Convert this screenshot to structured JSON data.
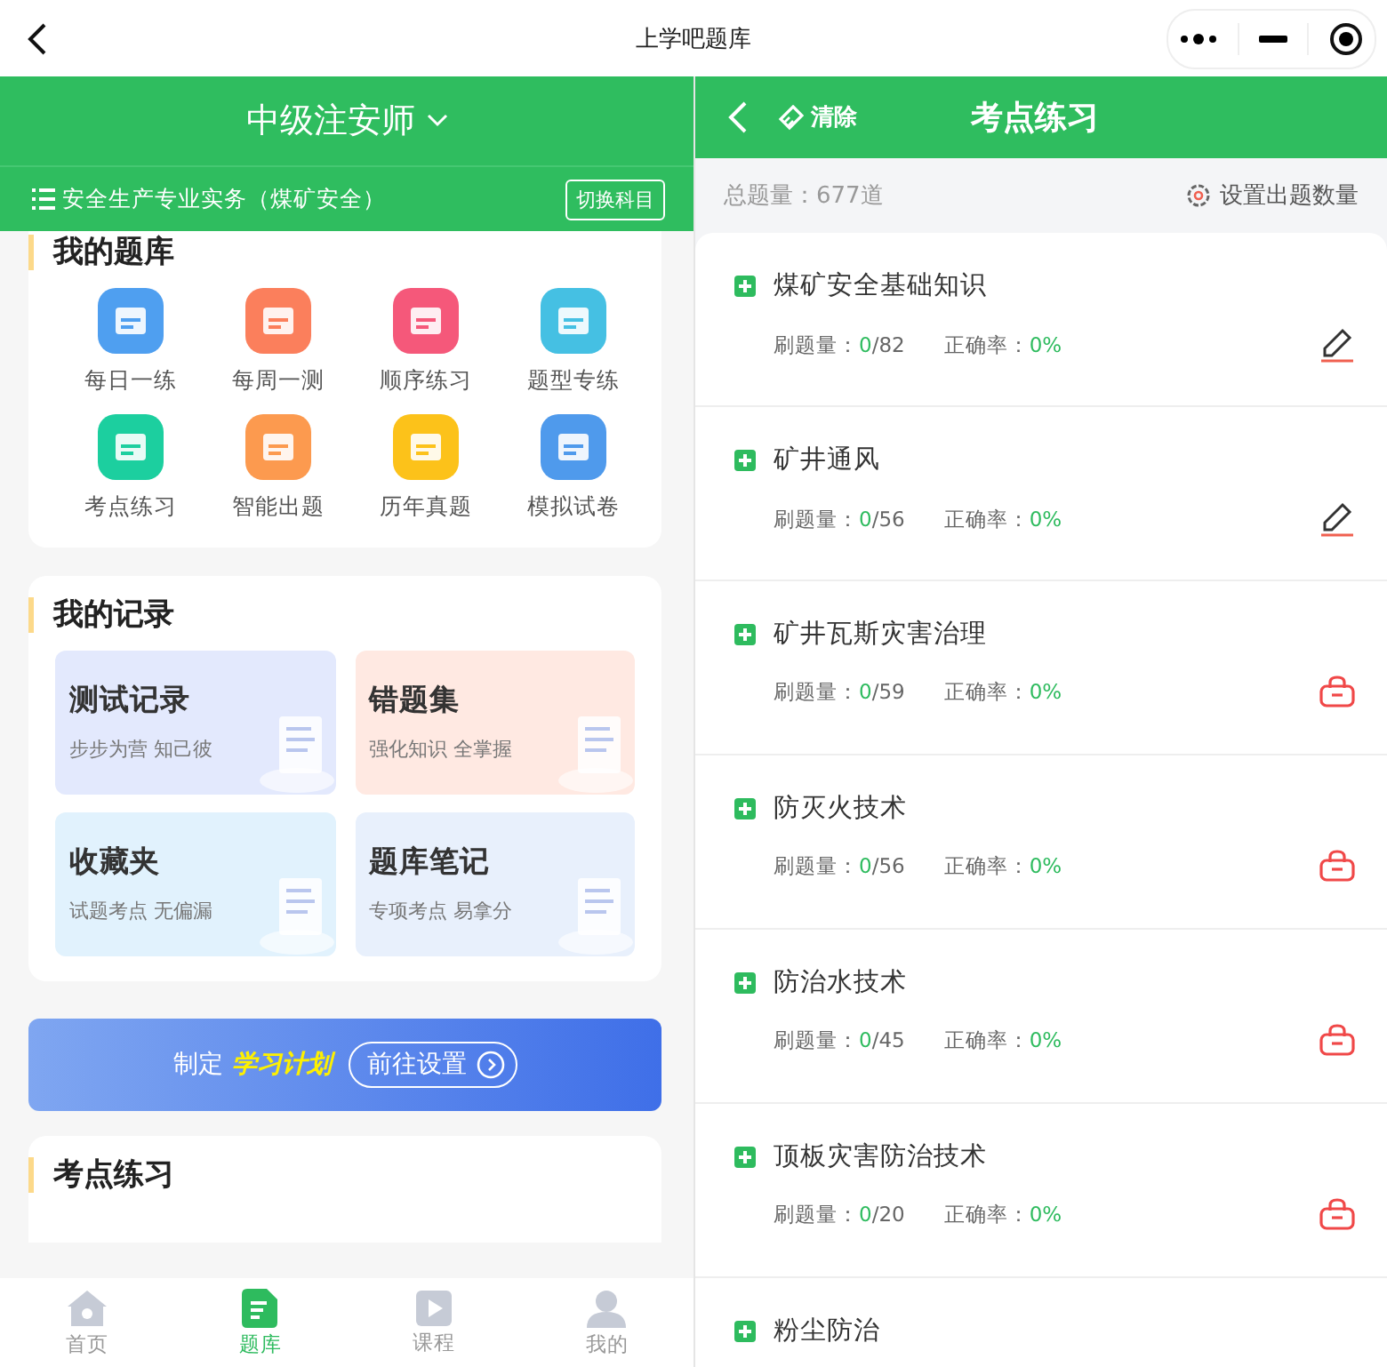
{
  "topbar": {
    "title": "上学吧题库"
  },
  "left": {
    "exam": "中级注安师",
    "subject": "安全生产专业实务（煤矿安全）",
    "switch_button": "切换科目",
    "bank": {
      "title": "我的题库",
      "items": [
        {
          "label": "每日一练",
          "color": "#4f9ff0"
        },
        {
          "label": "每周一测",
          "color": "#fb7f5c"
        },
        {
          "label": "顺序练习",
          "color": "#f5587a"
        },
        {
          "label": "题型专练",
          "color": "#45c0e3"
        },
        {
          "label": "考点练习",
          "color": "#1ccf9f"
        },
        {
          "label": "智能出题",
          "color": "#fc9a4f"
        },
        {
          "label": "历年真题",
          "color": "#fcc21a"
        },
        {
          "label": "模拟试卷",
          "color": "#4f9aec"
        }
      ]
    },
    "records": {
      "title": "我的记录",
      "cards": [
        {
          "title": "测试记录",
          "subtitle": "步步为营 知己彼",
          "color": "#e3e9fd"
        },
        {
          "title": "错题集",
          "subtitle": "强化知识 全掌握",
          "color": "#ffe9e2"
        },
        {
          "title": "收藏夹",
          "subtitle": "试题考点 无偏漏",
          "color": "#e1f2fd"
        },
        {
          "title": "题库笔记",
          "subtitle": "专项考点 易拿分",
          "color": "#e8f0fc"
        }
      ]
    },
    "banner": {
      "prefix": "制定",
      "highlight": "学习计划",
      "button": "前往设置"
    },
    "practice": {
      "title": "考点练习"
    },
    "tabs": [
      {
        "label": "首页",
        "selected": false
      },
      {
        "label": "题库",
        "selected": true
      },
      {
        "label": "课程",
        "selected": false
      },
      {
        "label": "我的",
        "selected": false
      }
    ]
  },
  "right": {
    "clear": "清除",
    "title": "考点练习",
    "total": "总题量：677道",
    "settings": "设置出题数量",
    "items": [
      {
        "name": "煤矿安全基础知识",
        "done_label": "刷题量：",
        "done": "0",
        "total": "/82",
        "rate_label": "正确率：",
        "rate": "0%",
        "locked": false
      },
      {
        "name": "矿井通风",
        "done_label": "刷题量：",
        "done": "0",
        "total": "/56",
        "rate_label": "正确率：",
        "rate": "0%",
        "locked": false
      },
      {
        "name": "矿井瓦斯灾害治理",
        "done_label": "刷题量：",
        "done": "0",
        "total": "/59",
        "rate_label": "正确率：",
        "rate": "0%",
        "locked": true
      },
      {
        "name": "防灭火技术",
        "done_label": "刷题量：",
        "done": "0",
        "total": "/56",
        "rate_label": "正确率：",
        "rate": "0%",
        "locked": true
      },
      {
        "name": "防治水技术",
        "done_label": "刷题量：",
        "done": "0",
        "total": "/45",
        "rate_label": "正确率：",
        "rate": "0%",
        "locked": true
      },
      {
        "name": "顶板灾害防治技术",
        "done_label": "刷题量：",
        "done": "0",
        "total": "/20",
        "rate_label": "正确率：",
        "rate": "0%",
        "locked": true
      },
      {
        "name": "粉尘防治"
      }
    ]
  }
}
